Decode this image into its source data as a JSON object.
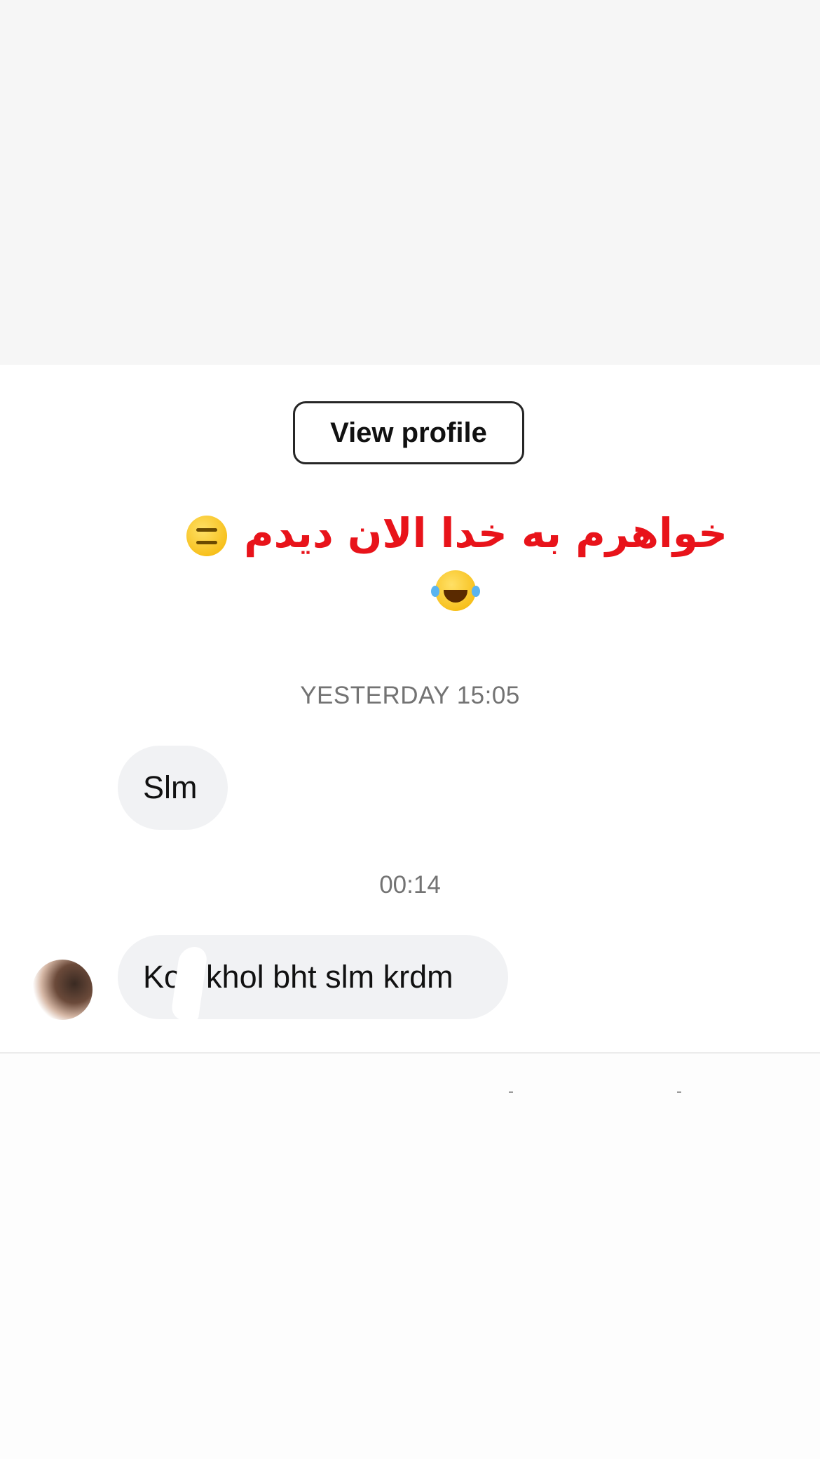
{
  "profile": {
    "view_profile_label": "View profile"
  },
  "overlay": {
    "caption_text": "خواهرم به خدا الان دیدم",
    "emoji_1": "neutral-face-emoji",
    "emoji_2": "laughing-tears-emoji",
    "color": "#e8131a"
  },
  "messages": [
    {
      "timestamp": "YESTERDAY 15:05",
      "text": "Slm"
    },
    {
      "timestamp": "00:14",
      "text": "Kos khol bht slm krdm"
    }
  ],
  "colors": {
    "bubble_bg": "#f1f2f4",
    "timestamp_text": "#737373",
    "header_bg": "#f6f6f6"
  }
}
